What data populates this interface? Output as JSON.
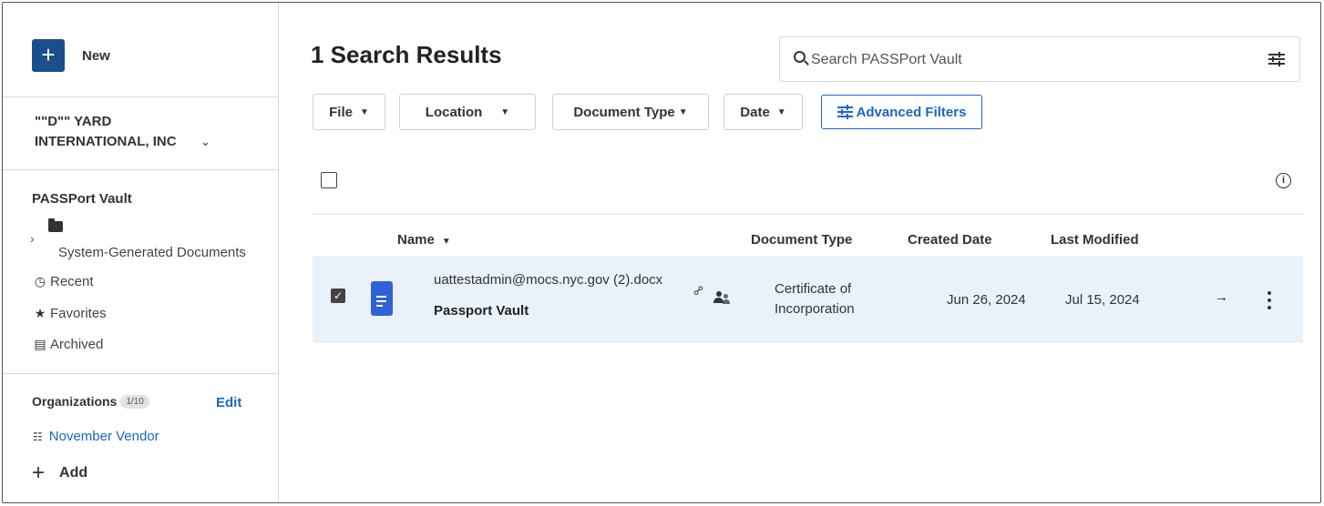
{
  "sidebar": {
    "new_label": "New",
    "org_line1": "\"\"D\"\" YARD",
    "org_line2": "INTERNATIONAL, INC",
    "vault_title": "PASSPort Vault",
    "folder_label": "System-Generated Documents",
    "nav": {
      "recent": "Recent",
      "favorites": "Favorites",
      "archived": "Archived"
    },
    "orgs_label": "Organizations",
    "orgs_count": "1/10",
    "edit_label": "Edit",
    "vendor_label": "November Vendor",
    "add_label": "Add"
  },
  "main": {
    "title": "1 Search Results",
    "search_placeholder": "Search PASSPort Vault",
    "filters": {
      "file": "File",
      "location": "Location",
      "doc_type": "Document Type",
      "date": "Date",
      "advanced": "Advanced Filters"
    },
    "columns": {
      "name": "Name",
      "doc_type": "Document Type",
      "created": "Created Date",
      "modified": "Last Modified"
    },
    "rows": [
      {
        "name": "uattestadmin@mocs.nyc.gov (2).docx",
        "location": "Passport Vault",
        "doc_type_line1": "Certificate of",
        "doc_type_line2": "Incorporation",
        "created": "Jun 26, 2024",
        "modified": "Jul 15, 2024",
        "selected": true
      }
    ]
  },
  "icons": {
    "new": "plus-icon",
    "org_chevron": "chevron-down-icon",
    "folder": "folder-icon",
    "recent": "clock-icon",
    "favorites": "star-icon",
    "archived": "archive-icon",
    "vendor": "org-tree-icon",
    "search": "search-icon",
    "tune": "tune-icon",
    "info": "info-icon",
    "doc": "document-icon",
    "link": "link-icon",
    "shared": "shared-users-icon",
    "open": "arrow-right-icon",
    "more": "more-vertical-icon"
  },
  "colors": {
    "primary_dark": "#1b4f8b",
    "link_blue": "#1b64c8",
    "row_selected_bg": "#e9f2fb",
    "doc_icon_blue": "#2f62d6"
  }
}
